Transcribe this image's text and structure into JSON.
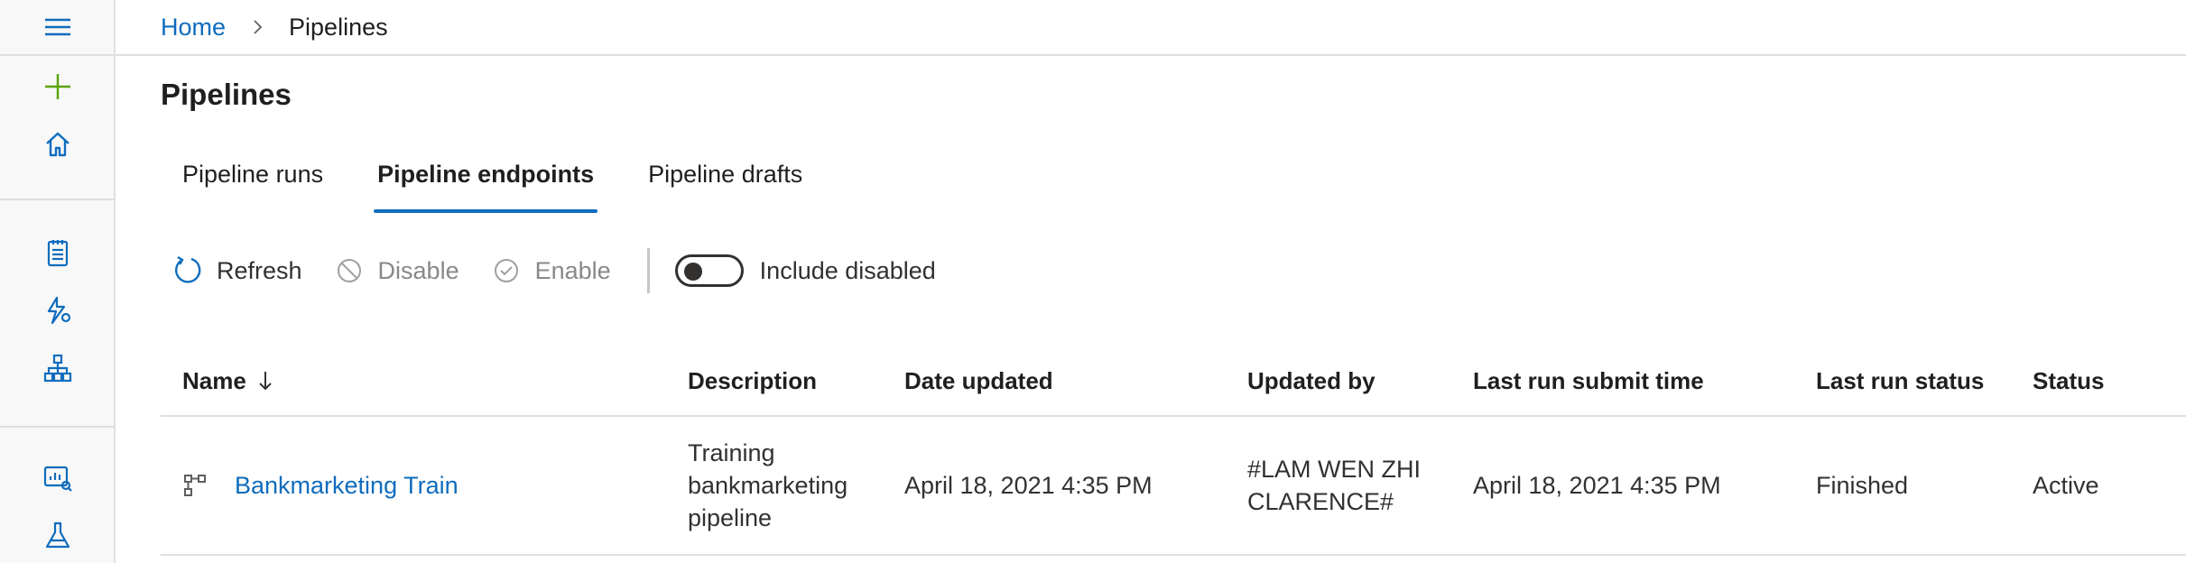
{
  "breadcrumb": {
    "home": "Home",
    "current": "Pipelines"
  },
  "page": {
    "title": "Pipelines"
  },
  "tabs": [
    {
      "label": "Pipeline runs",
      "active": false
    },
    {
      "label": "Pipeline endpoints",
      "active": true
    },
    {
      "label": "Pipeline drafts",
      "active": false
    }
  ],
  "toolbar": {
    "refresh": "Refresh",
    "disable": "Disable",
    "enable": "Enable",
    "include_disabled": "Include disabled",
    "include_disabled_on": false
  },
  "table": {
    "columns": [
      "Name",
      "Description",
      "Date updated",
      "Updated by",
      "Last run submit time",
      "Last run status",
      "Status"
    ],
    "sort_column": "Name",
    "sort_direction": "descending",
    "rows": [
      {
        "name": "Bankmarketing Train",
        "description": "Training bankmarketing pipeline",
        "date_updated": "April 18, 2021 4:35 PM",
        "updated_by": "#LAM WEN ZHI CLARENCE#",
        "last_run_submit_time": "April 18, 2021 4:35 PM",
        "last_run_status": "Finished",
        "status": "Active"
      }
    ]
  },
  "colors": {
    "accent": "#0f6cbd",
    "add_icon": "#57a300",
    "border": "#e1dfdd",
    "text": "#323130",
    "disabled_text": "#8a8886"
  },
  "sidebar_icons": [
    "hamburger-icon",
    "add-icon",
    "home-icon",
    "notebook-icon",
    "automl-icon",
    "designer-icon",
    "datasets-icon",
    "experiments-icon"
  ]
}
